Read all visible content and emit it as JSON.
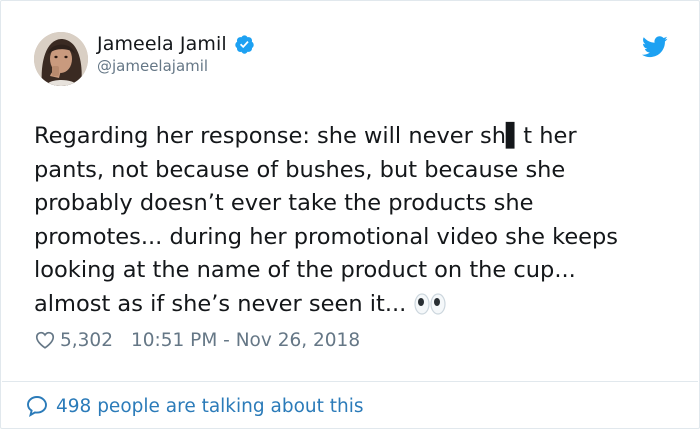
{
  "user": {
    "display_name": "Jameela Jamil",
    "handle": "@jameelajamil"
  },
  "tweet": {
    "text": "Regarding her response: she will never sh▌t her\npants, not because of bushes, but because she\nprobably doesn’t ever take the products she\npromotes... during her promotional video she keeps\nlooking at the name of the product on the cup...\nalmost as if she’s never seen it...",
    "emoji": "eyes-emoji"
  },
  "meta": {
    "likes": "5,302",
    "timestamp": "10:51 PM - Nov 26, 2018"
  },
  "footer": {
    "talking_label": "498 people are talking about this"
  },
  "colors": {
    "twitter_blue": "#1da1f2",
    "link_blue": "#2b7bb9",
    "muted": "#657786",
    "border": "#e1e8ed"
  },
  "icons": [
    "avatar",
    "verified-badge-icon",
    "twitter-bird-icon",
    "heart-icon",
    "comment-bubble-icon"
  ]
}
